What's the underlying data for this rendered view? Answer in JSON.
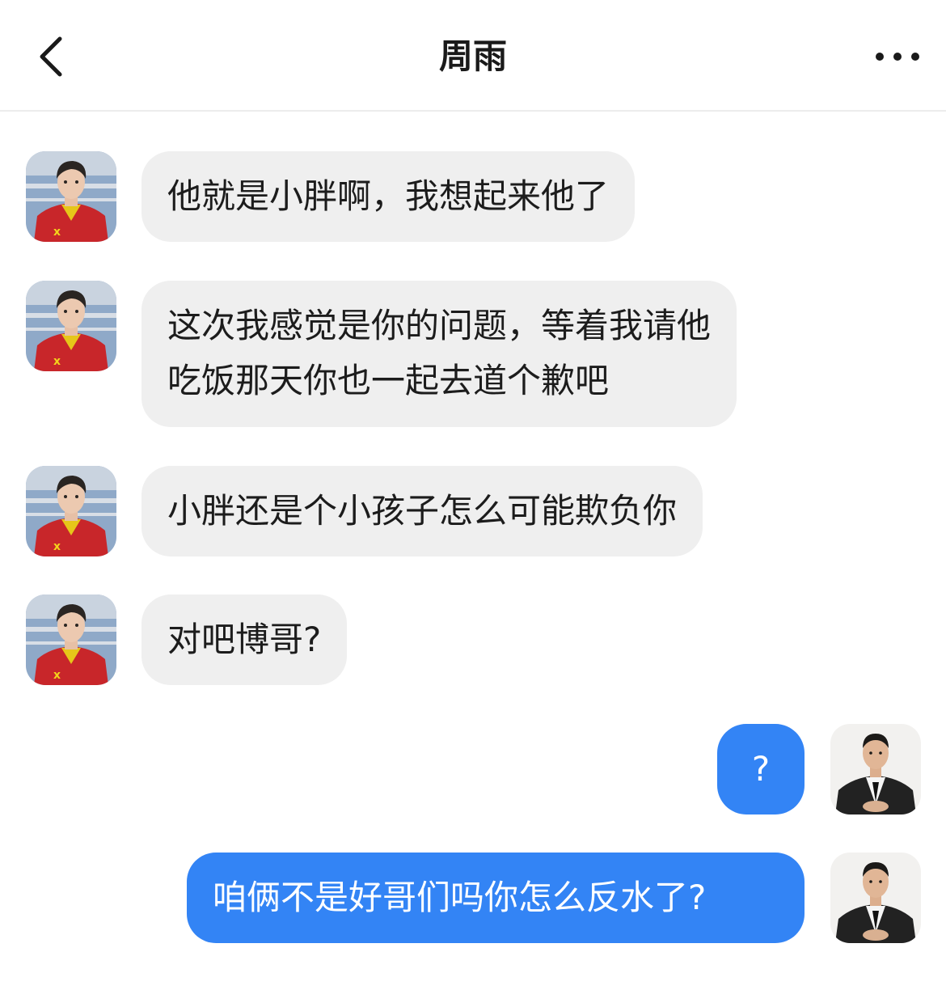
{
  "header": {
    "title": "周雨",
    "back_icon": "chevron-left-icon",
    "more_icon": "more-horizontal-icon"
  },
  "messages": [
    {
      "from": "contact",
      "text": "他就是小胖啊，我想起来他了"
    },
    {
      "from": "contact",
      "lines": [
        "这次我感觉是你的问题，等着我请他",
        "吃饭那天你也一起去道个歉吧"
      ]
    },
    {
      "from": "contact",
      "text": "小胖还是个小孩子怎么可能欺负你"
    },
    {
      "from": "contact",
      "text": "对吧博哥?"
    },
    {
      "from": "me",
      "text": "?"
    },
    {
      "from": "me",
      "text": "咱俩不是好哥们吗你怎么反水了?"
    }
  ],
  "colors": {
    "incoming_bubble": "#efefef",
    "outgoing_bubble": "#3384f5",
    "outgoing_text": "#ffffff",
    "header_divider": "#ececec"
  }
}
